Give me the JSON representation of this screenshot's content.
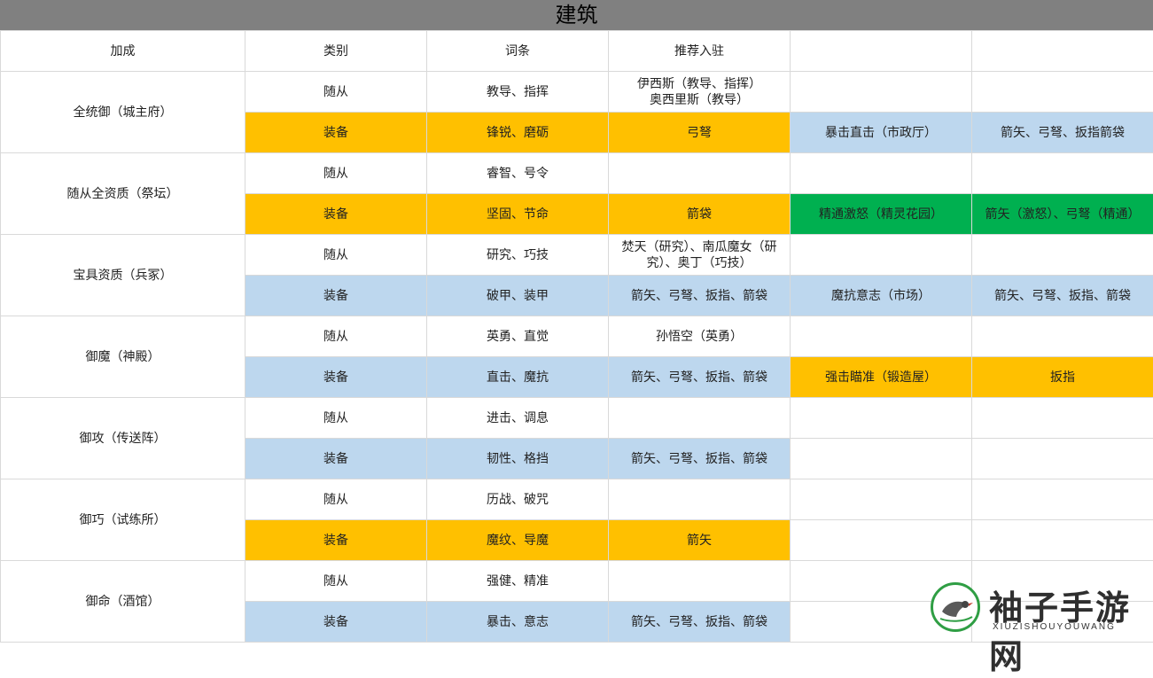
{
  "title": "建筑",
  "headers": [
    "加成",
    "类别",
    "词条",
    "推荐入驻",
    "",
    ""
  ],
  "groups": [
    {
      "bonus": "全统御（城主府）",
      "rows": [
        {
          "category": "随从",
          "entry": "教导、指挥",
          "recommend": "伊西斯（教导、指挥）\n奥西里斯（教导）",
          "extra1": "",
          "extra2": ""
        },
        {
          "category": "装备",
          "entry": "锋锐、磨砺",
          "recommend": "弓弩",
          "extra1": "暴击直击（市政厅）",
          "extra2": "箭矢、弓弩、扳指箭袋"
        }
      ]
    },
    {
      "bonus": "随从全资质（祭坛）",
      "rows": [
        {
          "category": "随从",
          "entry": "睿智、号令",
          "recommend": "",
          "extra1": "",
          "extra2": ""
        },
        {
          "category": "装备",
          "entry": "坚固、节命",
          "recommend": "箭袋",
          "extra1": "精通激怒（精灵花园）",
          "extra2": "箭矢（激怒）、弓弩（精通）"
        }
      ]
    },
    {
      "bonus": "宝具资质（兵冢）",
      "rows": [
        {
          "category": "随从",
          "entry": "研究、巧技",
          "recommend": "焚天（研究）、南瓜魔女（研究）、奥丁（巧技）",
          "extra1": "",
          "extra2": ""
        },
        {
          "category": "装备",
          "entry": "破甲、装甲",
          "recommend": "箭矢、弓弩、扳指、箭袋",
          "extra1": "魔抗意志（市场）",
          "extra2": "箭矢、弓弩、扳指、箭袋"
        }
      ]
    },
    {
      "bonus": "御魔（神殿）",
      "rows": [
        {
          "category": "随从",
          "entry": "英勇、直觉",
          "recommend": "孙悟空（英勇）",
          "extra1": "",
          "extra2": ""
        },
        {
          "category": "装备",
          "entry": "直击、魔抗",
          "recommend": "箭矢、弓弩、扳指、箭袋",
          "extra1": "强击瞄准（锻造屋）",
          "extra2": "扳指"
        }
      ]
    },
    {
      "bonus": "御攻（传送阵）",
      "rows": [
        {
          "category": "随从",
          "entry": "进击、调息",
          "recommend": "",
          "extra1": "",
          "extra2": ""
        },
        {
          "category": "装备",
          "entry": "韧性、格挡",
          "recommend": "箭矢、弓弩、扳指、箭袋",
          "extra1": "",
          "extra2": ""
        }
      ]
    },
    {
      "bonus": "御巧（试练所）",
      "rows": [
        {
          "category": "随从",
          "entry": "历战、破咒",
          "recommend": "",
          "extra1": "",
          "extra2": ""
        },
        {
          "category": "装备",
          "entry": "魔纹、导魔",
          "recommend": "箭矢",
          "extra1": "",
          "extra2": ""
        }
      ]
    },
    {
      "bonus": "御命（酒馆）",
      "rows": [
        {
          "category": "随从",
          "entry": "强健、精准",
          "recommend": "",
          "extra1": "",
          "extra2": ""
        },
        {
          "category": "装备",
          "entry": "暴击、意志",
          "recommend": "箭矢、弓弩、扳指、箭袋",
          "extra1": "",
          "extra2": ""
        }
      ]
    }
  ],
  "watermark": {
    "name": "袖子手游网",
    "sub": "XIUZISHOUYOUWANG",
    "icon": "bird-logo-icon"
  },
  "colors": {
    "gold": "#ffc000",
    "blue": "#bdd7ee",
    "green": "#00b050",
    "title_bar": "#808080"
  }
}
